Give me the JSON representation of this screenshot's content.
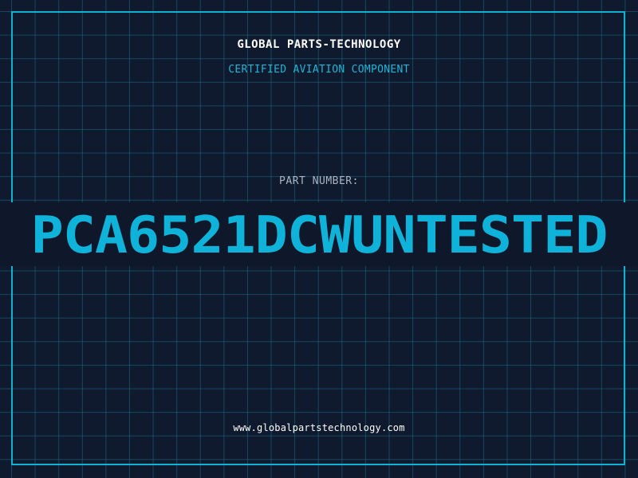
{
  "header": {
    "company": "GLOBAL PARTS-TECHNOLOGY",
    "tagline": "CERTIFIED AVIATION COMPONENT"
  },
  "part": {
    "label": "PART NUMBER:",
    "number": "PCA6521DCWUNTESTED"
  },
  "footer": {
    "website": "www.globalpartstechnology.com"
  },
  "colors": {
    "background": "#101a2e",
    "grid": "#186e87",
    "accent": "#0fb3d9",
    "text": "#ffffff",
    "label": "#aab4c4"
  }
}
